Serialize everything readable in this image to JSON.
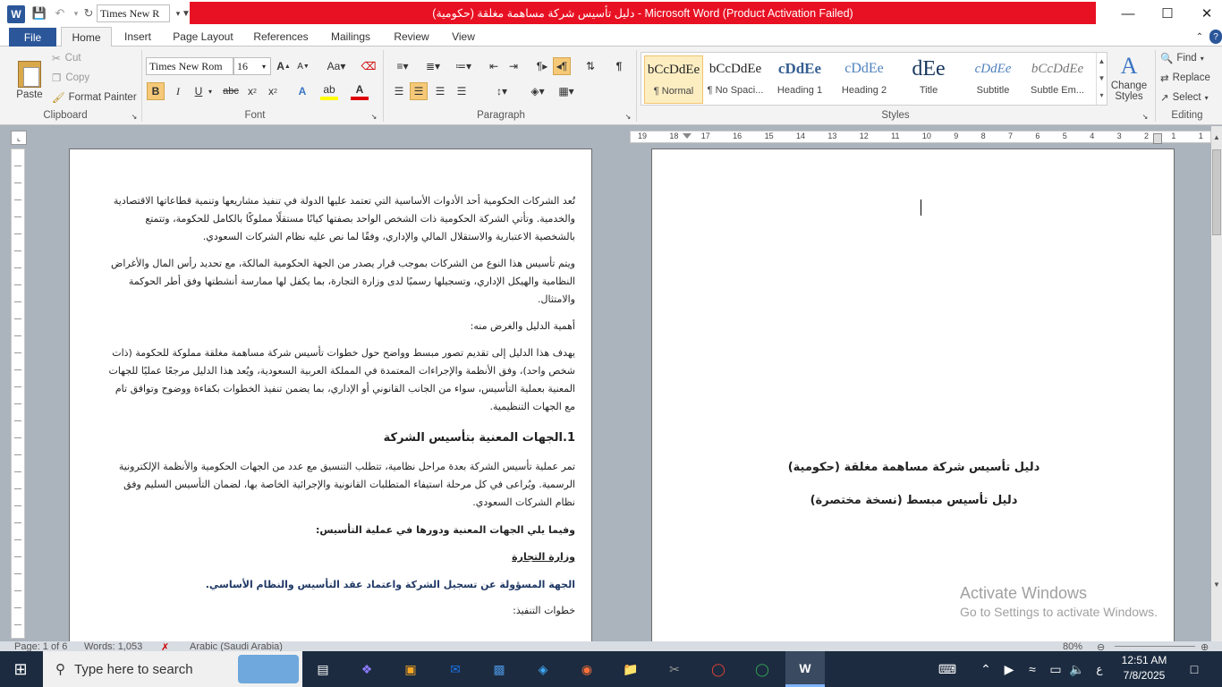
{
  "titlebar": {
    "title": "دليل تأسيس شركة مساهمة مغلقة (حكومية)  -  Microsoft Word (Product Activation Failed)",
    "font_value": "Times New R",
    "accent": "#e81123"
  },
  "tabs": [
    "File",
    "Home",
    "Insert",
    "Page Layout",
    "References",
    "Mailings",
    "Review",
    "View"
  ],
  "clipboard": {
    "paste": "Paste",
    "cut": "Cut",
    "copy": "Copy",
    "format_painter": "Format Painter",
    "label": "Clipboard"
  },
  "font": {
    "name": "Times New Rom",
    "size": "16",
    "label": "Font"
  },
  "paragraph": {
    "label": "Paragraph"
  },
  "styles": {
    "label": "Styles",
    "items": [
      {
        "preview": "bCcDdEe",
        "name": "¶ Normal"
      },
      {
        "preview": "bCcDdEe",
        "name": "¶ No Spaci..."
      },
      {
        "preview": "cDdEe",
        "name": "Heading 1"
      },
      {
        "preview": "cDdEe",
        "name": "Heading 2"
      },
      {
        "preview": "dEe",
        "name": "Title"
      },
      {
        "preview": "cDdEe",
        "name": "Subtitle"
      },
      {
        "preview": "bCcDdEe",
        "name": "Subtle Em..."
      }
    ],
    "change_styles": "Change Styles"
  },
  "editing": {
    "find": "Find",
    "replace": "Replace",
    "select": "Select",
    "label": "Editing"
  },
  "ruler_numbers": [
    "19",
    "18",
    "17",
    "16",
    "15",
    "14",
    "13",
    "12",
    "11",
    "10",
    "9",
    "8",
    "7",
    "6",
    "5",
    "4",
    "3",
    "2",
    "1",
    "1"
  ],
  "left_page": {
    "p1": "تُعد الشركات الحكومية أحد الأدوات الأساسية التي تعتمد عليها الدولة في تنفيذ مشاريعها وتنمية قطاعاتها الاقتصادية والخدمية. وتأتي الشركة الحكومية ذات الشخص الواحد بصفتها كيانًا مستقلًا مملوكًا بالكامل للحكومة، وتتمتع بالشخصية الاعتبارية والاستقلال المالي والإداري، وفقًا لما نص عليه نظام الشركات السعودي.",
    "p2": "ويتم تأسيس هذا النوع من الشركات بموجب قرار يصدر من الجهة الحكومية المالكة، مع تحديد رأس المال والأغراض النظامية والهيكل الإداري، وتسجيلها رسميًا لدى وزارة التجارة، بما يكفل لها ممارسة أنشطتها وفق أطر الحوكمة والامتثال.",
    "p3": "أهمية الدليل والغرض منه:",
    "p4": "يهدف هذا الدليل إلى تقديم تصور مبسط وواضح حول خطوات تأسيس شركة مساهمة مغلقة مملوكة للحكومة (ذات شخص واحد)، وفق الأنظمة والإجراءات المعتمدة في المملكة العربية السعودية، ويُعد هذا الدليل مرجعًا عمليًا للجهات المعنية بعملية التأسيس، سواء من الجانب القانوني أو الإداري، بما يضمن تنفيذ الخطوات بكفاءة ووضوح وتوافق تام مع الجهات التنظيمية.",
    "heading": "1.الجهات المعنية بتأسيس الشركة",
    "p5": "تمر عملية تأسيس الشركة بعدة مراحل نظامية، تتطلب التنسيق مع عدد من الجهات الحكومية والأنظمة الإلكترونية الرسمية. ويُراعى في كل مرحلة استيفاء المتطلبات القانونية والإجرائية الخاصة بها، لضمان التأسيس السليم وفق نظام الشركات السعودي.",
    "p6": "وفيما يلي الجهات المعنية ودورها في عملية التأسيس:",
    "p7": "وزارة التجارة",
    "p8": "الجهة المسؤولة عن تسجيل الشركة واعتماد عقد التأسيس والنظام الأساسي.",
    "p9": "خطوات التنفيذ:"
  },
  "right_page": {
    "title1": "دليل تأسيس شركة مساهمة مغلقة (حكومية)",
    "title2": "دليل تأسيس مبسط (نسخة مختصرة)"
  },
  "watermark": {
    "line1": "Activate Windows",
    "line2": "Go to Settings to activate Windows."
  },
  "status": {
    "page": "Page: 1 of 6",
    "words": "Words: 1,053",
    "lang": "Arabic (Saudi Arabia)",
    "zoom": "80%"
  },
  "taskbar": {
    "search_placeholder": "Type here to search",
    "lang": "ع",
    "time": "12:51 AM",
    "date": "7/8/2025"
  }
}
